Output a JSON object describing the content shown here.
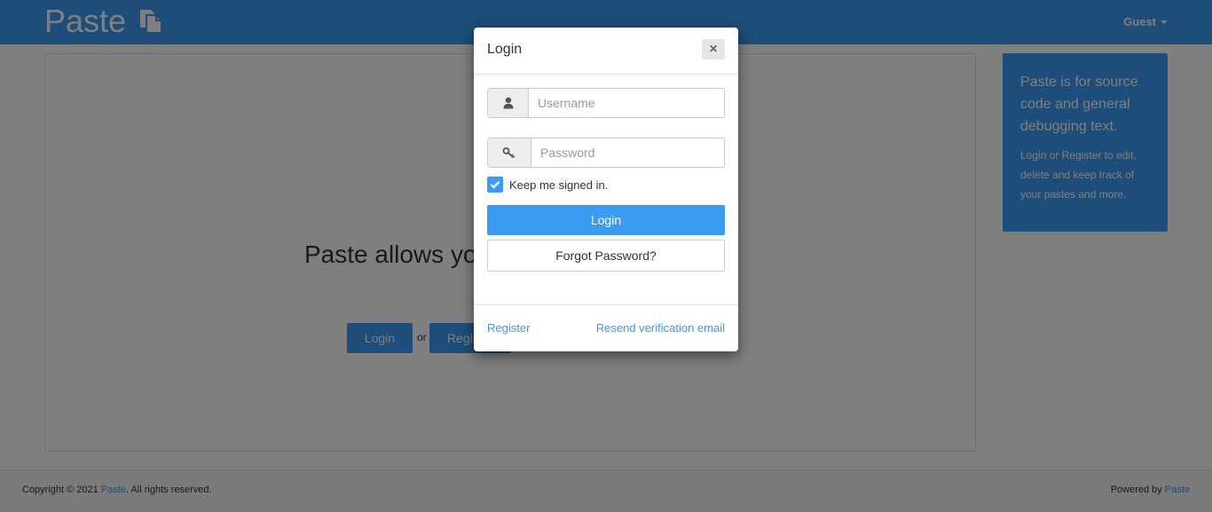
{
  "navbar": {
    "brand": "Paste",
    "brand_icon": "files-icon",
    "user_menu": "Guest"
  },
  "main": {
    "hero_text": "Paste allows you to share text",
    "login_button": "Login",
    "or_text": "or",
    "register_button": "Register"
  },
  "sidebar": {
    "title": "Paste is for source code and general debugging text.",
    "body": "Login or Register to edit, delete and keep track of your pastes and more."
  },
  "footer": {
    "copyright_prefix": "Copyright © 2021 ",
    "copyright_link": "Paste",
    "copyright_suffix": ". All rights reserved.",
    "powered_prefix": "Powered by ",
    "powered_link": "Paste"
  },
  "modal": {
    "title": "Login",
    "close_symbol": "×",
    "username_placeholder": "Username",
    "password_placeholder": "Password",
    "remember_label": "Keep me signed in.",
    "remember_checked": true,
    "login_button": "Login",
    "forgot_button": "Forgot Password?",
    "register_link": "Register",
    "resend_link": "Resend verification email"
  },
  "colors": {
    "primary": "#3a9bf0",
    "backdrop": "rgba(0,0,0,0.5)"
  }
}
